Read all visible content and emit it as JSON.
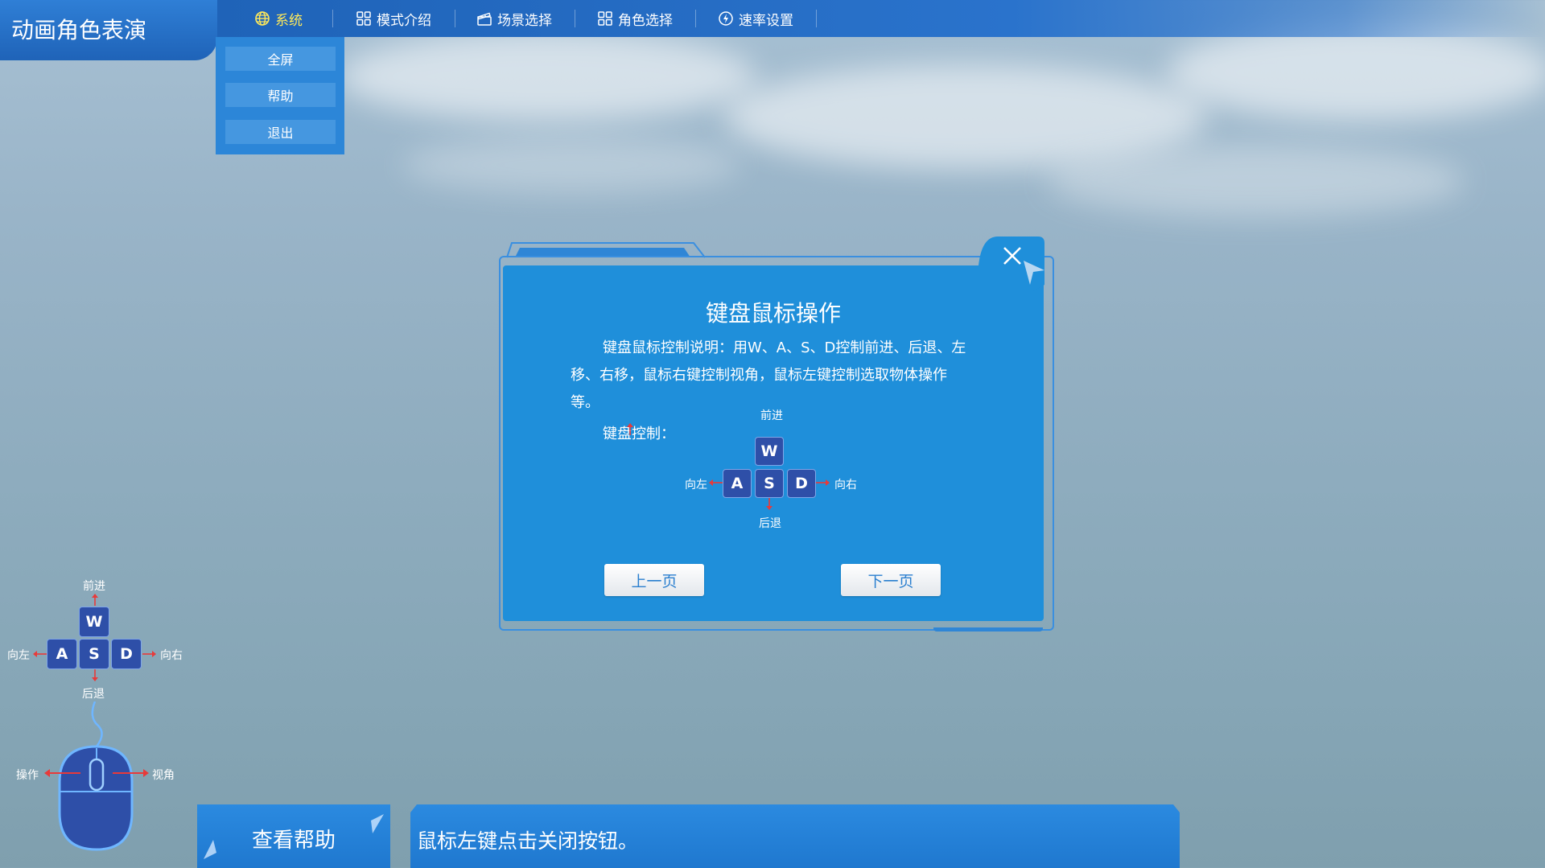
{
  "app": {
    "title": "动画角色表演"
  },
  "menu": {
    "items": [
      {
        "label": "系统",
        "icon": "globe-icon",
        "active": true
      },
      {
        "label": "模式介绍",
        "icon": "grid-icon"
      },
      {
        "label": "场景选择",
        "icon": "clapper-icon"
      },
      {
        "label": "角色选择",
        "icon": "grid-icon"
      },
      {
        "label": "速率设置",
        "icon": "lightning-icon"
      }
    ]
  },
  "dropdown": {
    "items": [
      "全屏",
      "帮助",
      "退出"
    ]
  },
  "dialog": {
    "title": "键盘鼠标操作",
    "text": "键盘鼠标控制说明：用W、A、S、D控制前进、后退、左移、右移，鼠标右键控制视角，鼠标左键控制选取物体操作等。",
    "subhead": "键盘控制：",
    "keys": {
      "w": "W",
      "a": "A",
      "s": "S",
      "d": "D"
    },
    "labels": {
      "forward": "前进",
      "back": "后退",
      "left": "向左",
      "right": "向右"
    },
    "prev_button": "上一页",
    "next_button": "下一页"
  },
  "left_guide": {
    "keys": {
      "w": "W",
      "a": "A",
      "s": "S",
      "d": "D"
    },
    "labels": {
      "forward": "前进",
      "back": "后退",
      "left": "向左",
      "right": "向右"
    },
    "mouse_left": "操作",
    "mouse_right": "视角"
  },
  "bottom": {
    "help_button": "查看帮助",
    "message": "鼠标左键点击关闭按钮。"
  },
  "colors": {
    "primary": "#1f8fda",
    "bar": "#1f63b8",
    "active_menu": "#ffe95a",
    "key_fill": "#2e4fa8",
    "arrow": "#e83a3a"
  }
}
